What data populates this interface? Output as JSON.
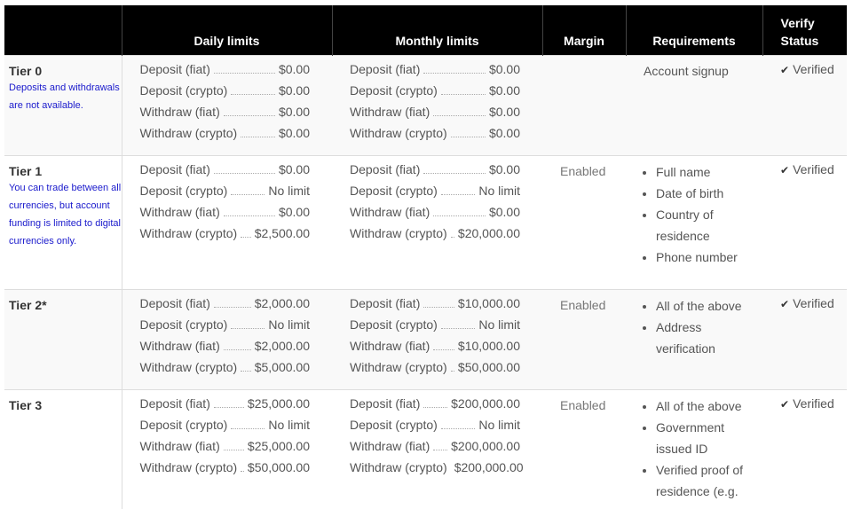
{
  "headers": {
    "tier": "",
    "daily": "Daily limits",
    "monthly": "Monthly limits",
    "margin": "Margin",
    "requirements": "Requirements",
    "verify_line1": "Verify",
    "verify_line2": "Status"
  },
  "tiers": [
    {
      "name": "Tier 0",
      "note": "Deposits and withdrawals are not available.",
      "daily": [
        {
          "label": "Deposit (fiat)",
          "value": "$0.00"
        },
        {
          "label": "Deposit (crypto)",
          "value": "$0.00"
        },
        {
          "label": "Withdraw (fiat)",
          "value": "$0.00"
        },
        {
          "label": "Withdraw (crypto)",
          "value": "$0.00"
        }
      ],
      "monthly": [
        {
          "label": "Deposit (fiat)",
          "value": "$0.00"
        },
        {
          "label": "Deposit (crypto)",
          "value": "$0.00"
        },
        {
          "label": "Withdraw (fiat)",
          "value": "$0.00"
        },
        {
          "label": "Withdraw (crypto)",
          "value": "$0.00"
        }
      ],
      "margin": "",
      "requirement_text": "Account signup",
      "requirements": [],
      "status": "Verified"
    },
    {
      "name": "Tier 1",
      "note": "You can trade between all currencies, but account funding is limited to digital currencies only.",
      "daily": [
        {
          "label": "Deposit (fiat)",
          "value": "$0.00"
        },
        {
          "label": "Deposit (crypto)",
          "value": "No limit"
        },
        {
          "label": "Withdraw (fiat)",
          "value": "$0.00"
        },
        {
          "label": "Withdraw (crypto)",
          "value": "$2,500.00"
        }
      ],
      "monthly": [
        {
          "label": "Deposit (fiat)",
          "value": "$0.00"
        },
        {
          "label": "Deposit (crypto)",
          "value": "No limit"
        },
        {
          "label": "Withdraw (fiat)",
          "value": "$0.00"
        },
        {
          "label": "Withdraw (crypto)",
          "value": "$20,000.00"
        }
      ],
      "margin": "Enabled",
      "requirement_text": "",
      "requirements": [
        "Full name",
        "Date of birth",
        "Country of residence",
        "Phone number"
      ],
      "status": "Verified"
    },
    {
      "name": "Tier 2*",
      "note": "",
      "daily": [
        {
          "label": "Deposit (fiat)",
          "value": "$2,000.00"
        },
        {
          "label": "Deposit (crypto)",
          "value": "No limit"
        },
        {
          "label": "Withdraw (fiat)",
          "value": "$2,000.00"
        },
        {
          "label": "Withdraw (crypto)",
          "value": "$5,000.00"
        }
      ],
      "monthly": [
        {
          "label": "Deposit (fiat)",
          "value": "$10,000.00"
        },
        {
          "label": "Deposit (crypto)",
          "value": "No limit"
        },
        {
          "label": "Withdraw (fiat)",
          "value": "$10,000.00"
        },
        {
          "label": "Withdraw (crypto)",
          "value": "$50,000.00"
        }
      ],
      "margin": "Enabled",
      "requirement_text": "",
      "requirements": [
        "All of the above",
        "Address verification"
      ],
      "status": "Verified"
    },
    {
      "name": "Tier 3",
      "note": "",
      "daily": [
        {
          "label": "Deposit (fiat)",
          "value": "$25,000.00"
        },
        {
          "label": "Deposit (crypto)",
          "value": "No limit"
        },
        {
          "label": "Withdraw (fiat)",
          "value": "$25,000.00"
        },
        {
          "label": "Withdraw (crypto)",
          "value": "$50,000.00"
        }
      ],
      "monthly": [
        {
          "label": "Deposit (fiat)",
          "value": "$200,000.00"
        },
        {
          "label": "Deposit (crypto)",
          "value": "No limit"
        },
        {
          "label": "Withdraw (fiat)",
          "value": "$200,000.00"
        },
        {
          "label": "Withdraw (crypto)",
          "value": "$200,000.00"
        }
      ],
      "margin": "Enabled",
      "requirement_text": "",
      "requirements": [
        "All of the above",
        "Government issued ID",
        "Verified proof of residence (e.g."
      ],
      "status": "Verified"
    }
  ],
  "icons": {
    "status_check": "check-icon"
  },
  "colors": {
    "header_bg": "#000000",
    "note_text": "#1a1acc",
    "stripe": "#f9f9f9"
  }
}
